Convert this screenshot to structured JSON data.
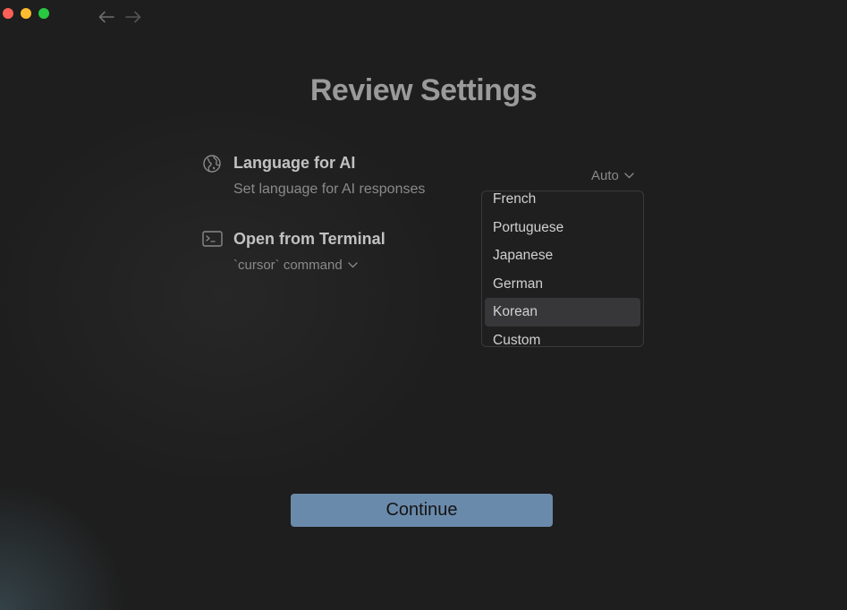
{
  "window": {
    "title": "Review Settings"
  },
  "language_setting": {
    "icon": "globe-icon",
    "title": "Language for AI",
    "description": "Set language for AI responses",
    "selected_value": "Auto"
  },
  "terminal_setting": {
    "icon": "terminal-icon",
    "title": "Open from Terminal",
    "command_value": "`cursor` command"
  },
  "language_dropdown": {
    "options": [
      "French",
      "Portuguese",
      "Japanese",
      "German",
      "Korean",
      "Custom"
    ],
    "highlighted": "Korean"
  },
  "footer": {
    "continue_label": "Continue"
  },
  "colors": {
    "background": "#1e1e1e",
    "primary_button": "#6a8aab",
    "highlight": "#37373a"
  }
}
